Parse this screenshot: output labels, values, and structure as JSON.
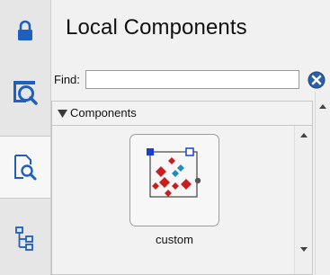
{
  "panel": {
    "title": "Local Components",
    "find_label": "Find:",
    "find_value": "",
    "group": {
      "label": "Components",
      "expanded": true
    },
    "components": [
      {
        "label": "custom"
      }
    ]
  },
  "rail": {
    "items": [
      {
        "icon": "lock-icon",
        "active": false
      },
      {
        "icon": "component-library-icon",
        "active": false
      },
      {
        "icon": "document-search-icon",
        "active": true
      },
      {
        "icon": "hierarchy-tree-icon",
        "active": false
      }
    ]
  },
  "colors": {
    "accent_blue": "#1f5fbf",
    "component_red": "#c81e1e",
    "component_teal": "#1f8fb5",
    "clear_icon_blue": "#2d5fa8"
  }
}
